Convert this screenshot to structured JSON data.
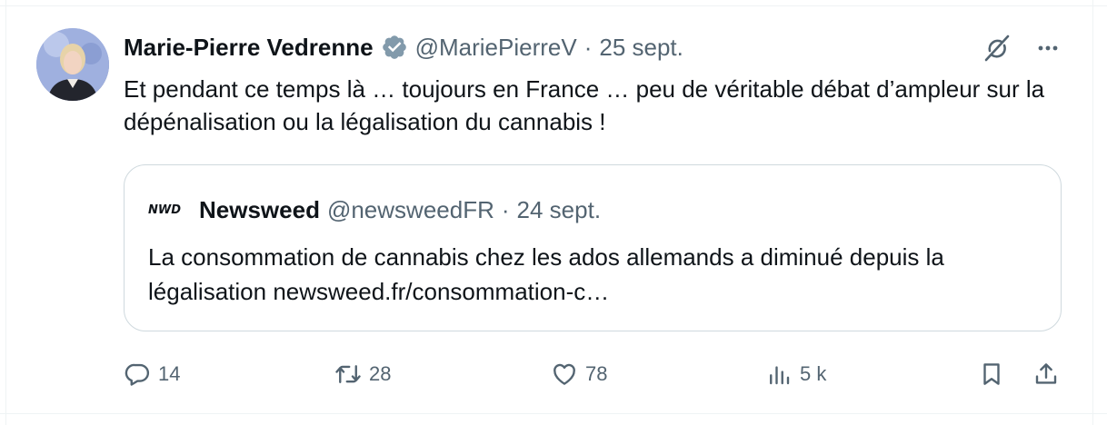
{
  "tweet": {
    "author_name": "Marie-Pierre Vedrenne",
    "handle": "@MariePierreV",
    "separator": "·",
    "date": "25 sept.",
    "text": "Et pendant ce temps là … toujours en France … peu de véritable débat d’ampleur sur la dépénalisation ou la légalisation du cannabis !"
  },
  "quote": {
    "logo_text": "NWD",
    "author_name": "Newsweed",
    "handle": "@newsweedFR",
    "separator": "·",
    "date": "24 sept.",
    "text": "La consommation de cannabis chez les ados allemands a diminué depuis la légalisation newsweed.fr/consommation-c…"
  },
  "actions": {
    "replies": "14",
    "reposts": "28",
    "likes": "78",
    "views": "5 k"
  },
  "icons": {
    "verified": "verified-badge-icon",
    "grok": "grok-icon",
    "more": "more-icon",
    "reply": "reply-icon",
    "repost": "repost-icon",
    "like": "heart-icon",
    "views": "views-icon",
    "bookmark": "bookmark-icon",
    "share": "share-icon"
  },
  "colors": {
    "text": "#0f1419",
    "secondary": "#536471",
    "border": "#cfd9de",
    "verified_badge": "#829aab"
  }
}
